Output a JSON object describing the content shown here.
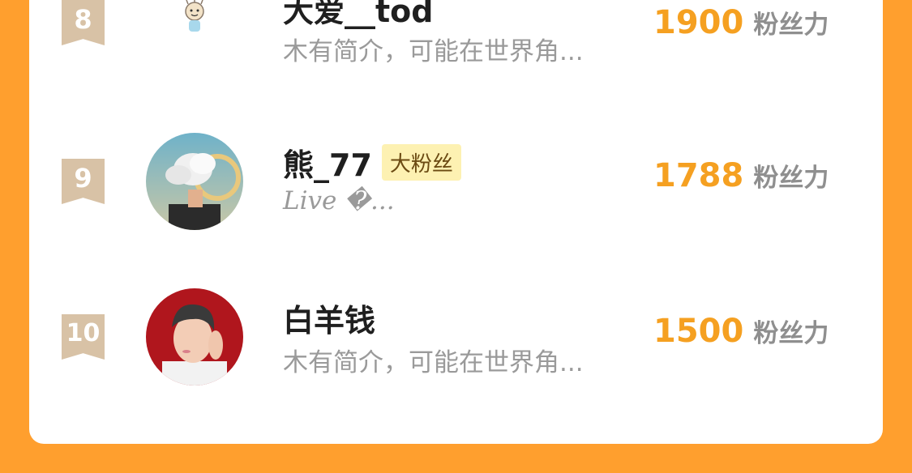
{
  "colors": {
    "background": "#ff9f2e",
    "score": "#f5a021",
    "rank_ribbon": "#d8c2a6",
    "badge_bg": "#fdf1b2"
  },
  "ranking": {
    "unit_label": "粉丝力",
    "items": [
      {
        "rank": "8",
        "name": "大爱__tod",
        "badge": "",
        "description": "木有简介，可能在世界角...",
        "score": "1900",
        "avatar_icon": "cartoon-kid-icon"
      },
      {
        "rank": "9",
        "name": "熊_77",
        "badge": "大粉丝",
        "description": "Live �...",
        "score": "1788",
        "avatar_icon": "smoke-portrait-avatar"
      },
      {
        "rank": "10",
        "name": "白羊钱",
        "badge": "",
        "description": "木有简介，可能在世界角...",
        "score": "1500",
        "avatar_icon": "portrait-avatar"
      }
    ]
  }
}
